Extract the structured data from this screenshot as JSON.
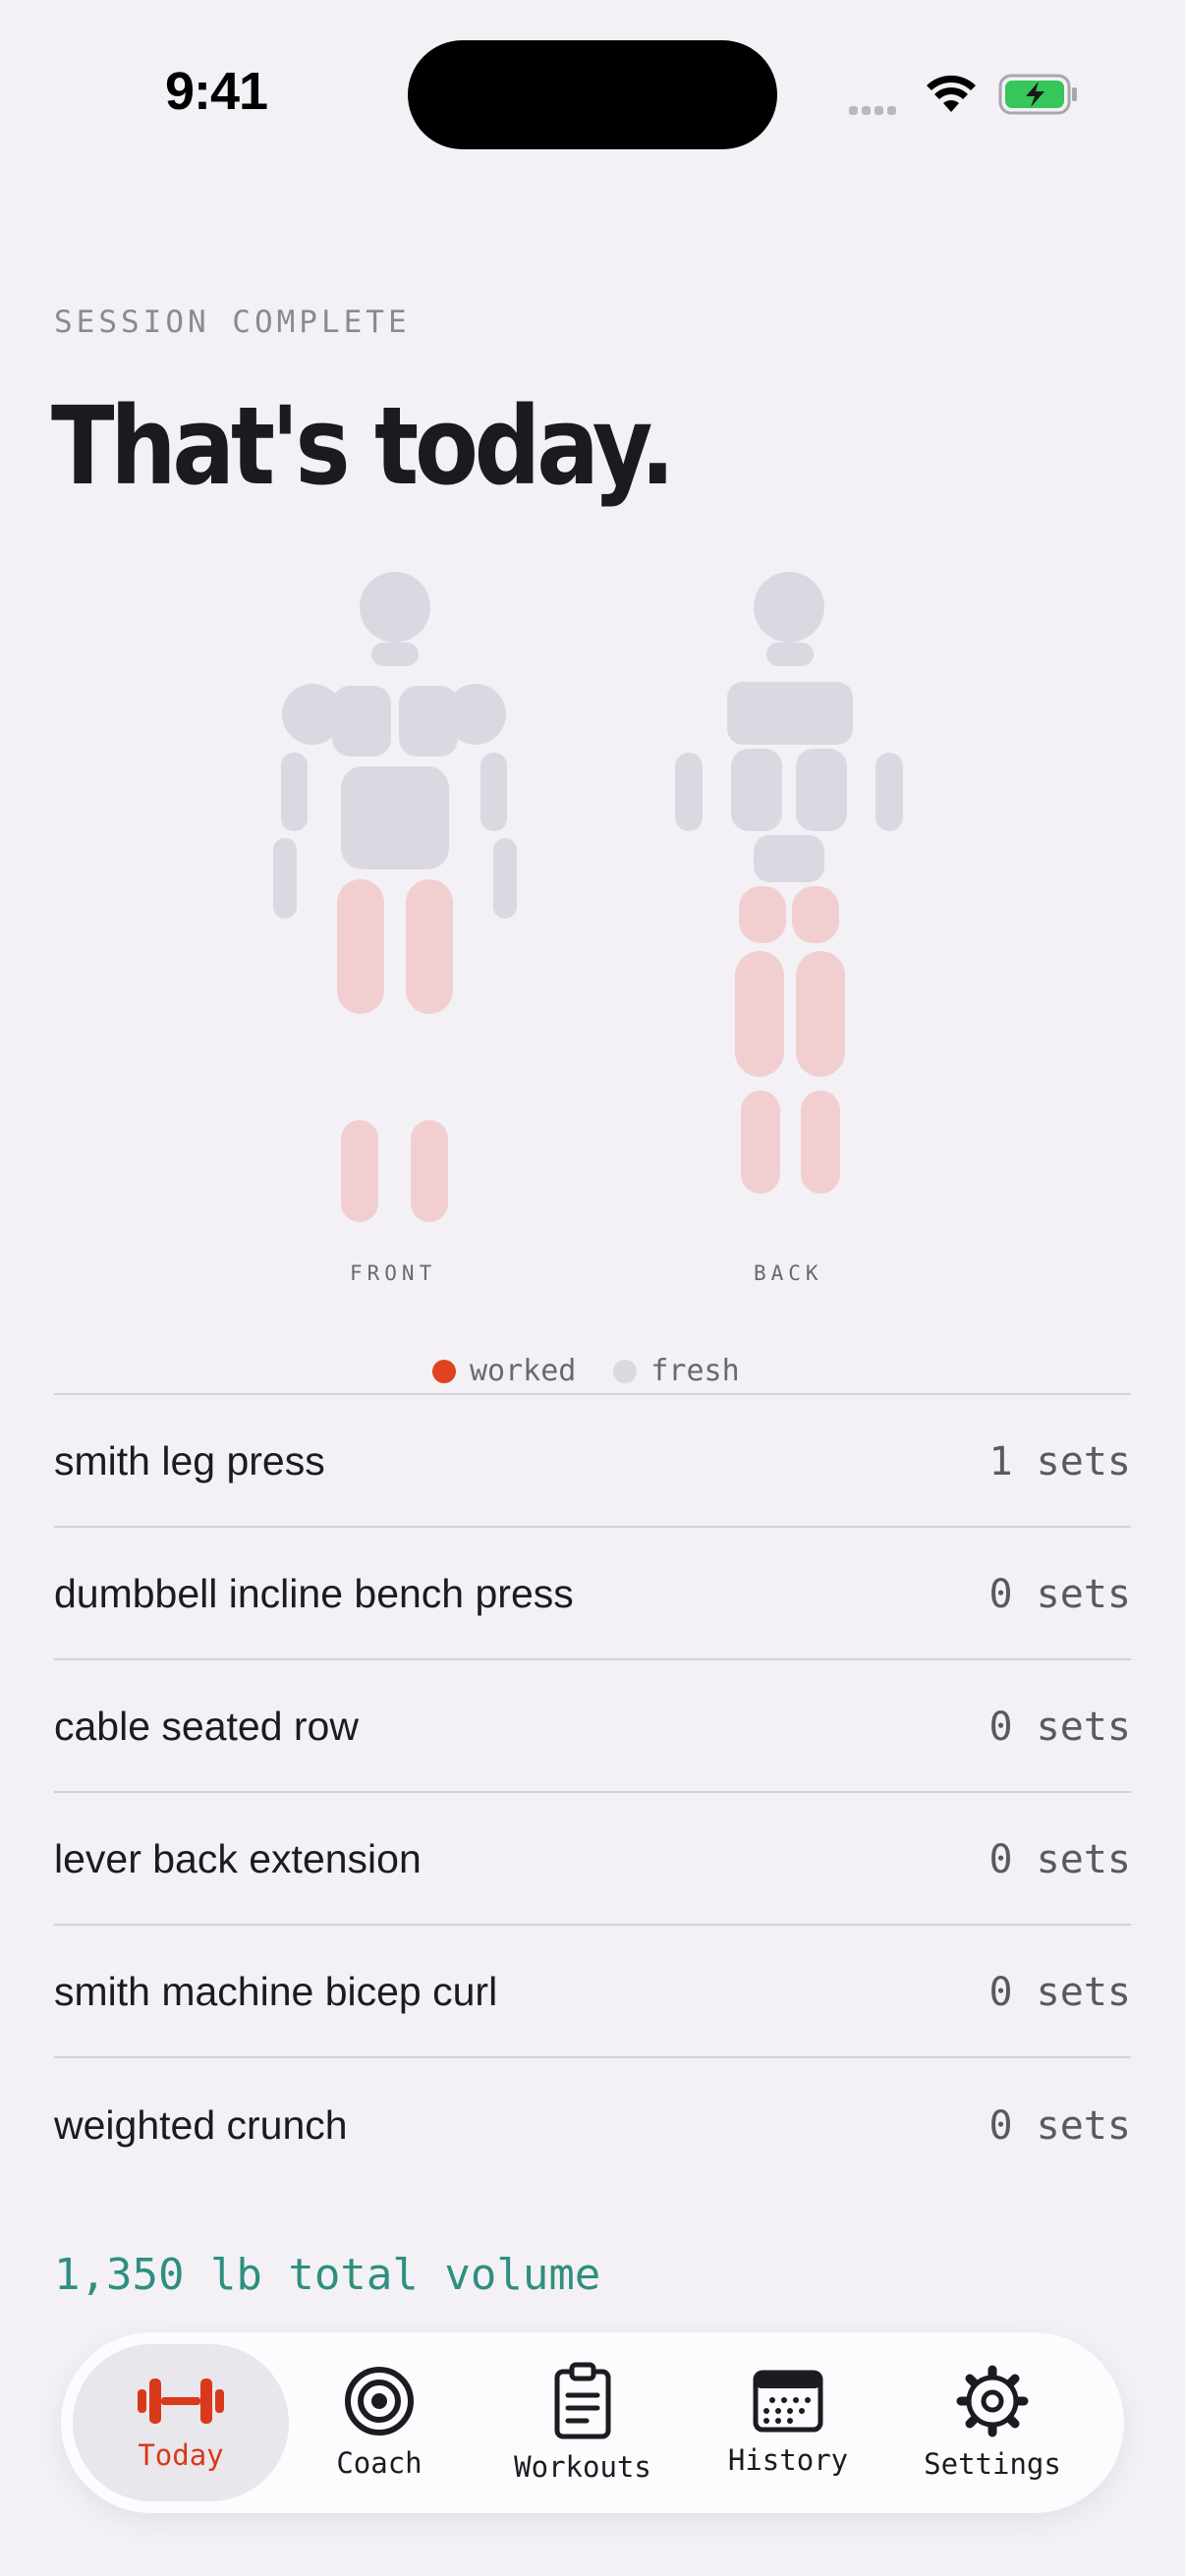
{
  "status_bar": {
    "time": "9:41"
  },
  "header": {
    "eyebrow": "SESSION COMPLETE",
    "title": "That's today."
  },
  "body_map": {
    "front_label": "FRONT",
    "back_label": "BACK",
    "colors": {
      "worked": "#f1cfd0",
      "fresh": "#dcd8e2"
    },
    "worked_regions": [
      "quads",
      "calves",
      "glutes",
      "hamstrings"
    ]
  },
  "legend": {
    "worked": {
      "label": "worked",
      "color": "#e0431f"
    },
    "fresh": {
      "label": "fresh",
      "color": "#dcd8e2"
    }
  },
  "exercises": [
    {
      "name": "smith leg press",
      "sets": "1 sets"
    },
    {
      "name": "dumbbell incline bench press",
      "sets": "0 sets"
    },
    {
      "name": "cable seated row",
      "sets": "0 sets"
    },
    {
      "name": "lever back extension",
      "sets": "0 sets"
    },
    {
      "name": "smith machine bicep curl",
      "sets": "0 sets"
    },
    {
      "name": "weighted crunch",
      "sets": "0 sets"
    }
  ],
  "total_volume": "1,350 lb total volume",
  "tab_bar": {
    "accent": "#d9391a",
    "tabs": [
      {
        "label": "Today",
        "icon": "dumbbell-icon",
        "active": true
      },
      {
        "label": "Coach",
        "icon": "target-icon",
        "active": false
      },
      {
        "label": "Workouts",
        "icon": "clipboard-icon",
        "active": false
      },
      {
        "label": "History",
        "icon": "calendar-icon",
        "active": false
      },
      {
        "label": "Settings",
        "icon": "gear-icon",
        "active": false
      }
    ]
  }
}
